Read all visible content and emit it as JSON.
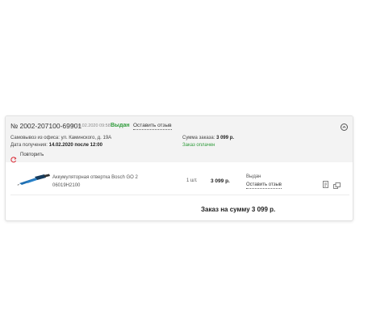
{
  "order": {
    "number": "№ 2002-207100-69901",
    "date_prefix": "от 10.02.2020 09:58",
    "status": "Выдан",
    "feedback_label": "Оставить отзыв",
    "pickup_label": "Самовывоз из офиса: ул. Каминского, д. 19А",
    "receive_date_label": "Дата получения:",
    "receive_date_value": "14.02.2020 после 12:00",
    "sum_label": "Сумма заказа:",
    "sum_value": "3 099 р.",
    "paid_label": "Заказ оплачен",
    "repeat_label": "Повторить",
    "collapse_icon": "chevron-up-icon",
    "total_label": "Заказ на сумму 3 099 р."
  },
  "items": [
    {
      "name": "Аккумуляторная отвертка Bosch GO 2",
      "sku": "06019H2100",
      "qty": "1 шт.",
      "price": "3 099 р.",
      "status": "Выдан",
      "feedback_label": "Оставить отзыв"
    }
  ],
  "colors": {
    "accent_green": "#2e9b3a",
    "repeat_icon": "#d9232e",
    "product_blue": "#1f6fb2"
  }
}
